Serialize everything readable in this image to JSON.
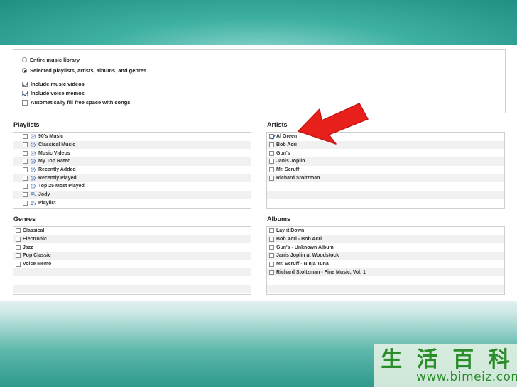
{
  "options": {
    "radio_entire": "Entire music library",
    "radio_selected": "Selected playlists, artists, albums, and genres",
    "include_videos": "Include music videos",
    "include_memos": "Include voice memos",
    "autofill": "Automatically fill free space with songs"
  },
  "playlists": {
    "title": "Playlists",
    "items": [
      {
        "label": "90's Music",
        "icon": "gear-icon"
      },
      {
        "label": "Classical Music",
        "icon": "gear-icon"
      },
      {
        "label": "Music Videos",
        "icon": "gear-icon"
      },
      {
        "label": "My Top Rated",
        "icon": "gear-icon"
      },
      {
        "label": "Recently Added",
        "icon": "gear-icon"
      },
      {
        "label": "Recently Played",
        "icon": "gear-icon"
      },
      {
        "label": "Top 25 Most Played",
        "icon": "gear-icon"
      },
      {
        "label": "Jody",
        "icon": "playlist-icon"
      },
      {
        "label": "Playlist",
        "icon": "playlist-icon"
      }
    ]
  },
  "artists": {
    "title": "Artists",
    "items": [
      {
        "label": "Al Green",
        "checked": true
      },
      {
        "label": "Bob Acri",
        "checked": false
      },
      {
        "label": "Gun's",
        "checked": false
      },
      {
        "label": "Janis Joplin",
        "checked": false
      },
      {
        "label": "Mr. Scruff",
        "checked": false
      },
      {
        "label": "Richard Stoltzman",
        "checked": false
      }
    ]
  },
  "genres": {
    "title": "Genres",
    "items": [
      "Classical",
      "Electronic",
      "Jazz",
      "Pop Classic",
      "Voice Memo"
    ]
  },
  "albums": {
    "title": "Albums",
    "items": [
      "Lay it Down",
      "Bob Acri - Bob Acri",
      "Gun's - Unknown Album",
      "Janis Joplin at Woodstock",
      "Mr. Scruff - Ninja Tuna",
      "Richard Stoltzman - Fine Music, Vol. 1"
    ]
  },
  "watermark": {
    "chars": [
      "生",
      "活",
      "百",
      "科"
    ],
    "url": "www.bimeiz.com"
  },
  "colors": {
    "accent_teal": "#2aa193",
    "arrow_red": "#e8201c"
  }
}
